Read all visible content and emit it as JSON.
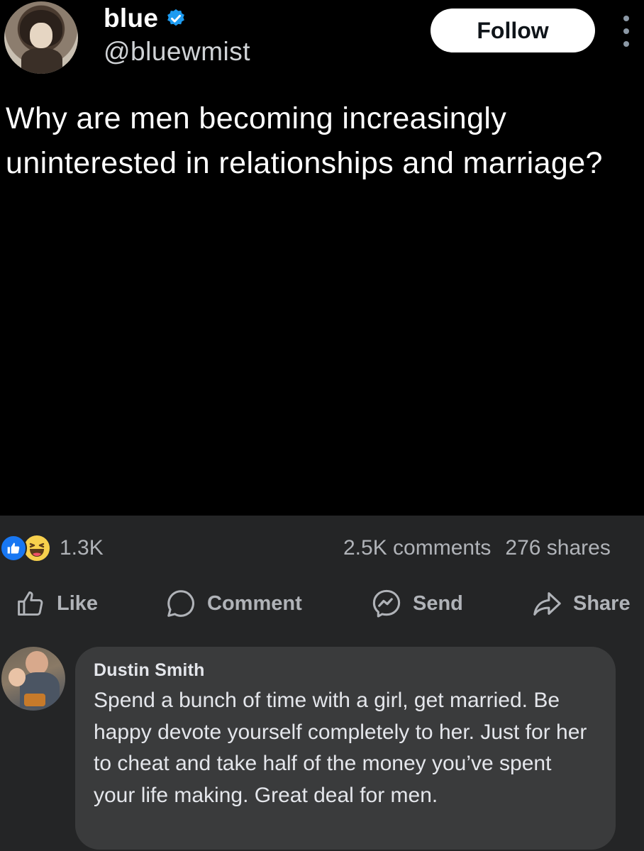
{
  "tweet": {
    "author_name": "blue",
    "author_handle": "@bluewmist",
    "verified_icon": "verified-badge-icon",
    "follow_label": "Follow",
    "text": "Why are men becoming increasingly uninterested in relationships and marriage?",
    "colors": {
      "background": "#000000",
      "verified": "#1d9bf0"
    }
  },
  "post_stats": {
    "reaction_icons": [
      "like-reaction-icon",
      "haha-reaction-icon"
    ],
    "reaction_count": "1.3K",
    "comments": "2.5K comments",
    "shares": "276 shares"
  },
  "actions": {
    "like_label": "Like",
    "comment_label": "Comment",
    "send_label": "Send",
    "share_label": "Share"
  },
  "comment": {
    "author": "Dustin Smith",
    "text": "Spend a bunch of time with a girl, get married. Be happy devote yourself completely to her. Just for her to cheat and take half of the money you’ve spent your life making. Great deal for men."
  },
  "theme": {
    "background": "#242526",
    "bubble": "#3a3b3c",
    "muted_text": "#b0b3b8",
    "accent": "#1877f2"
  }
}
